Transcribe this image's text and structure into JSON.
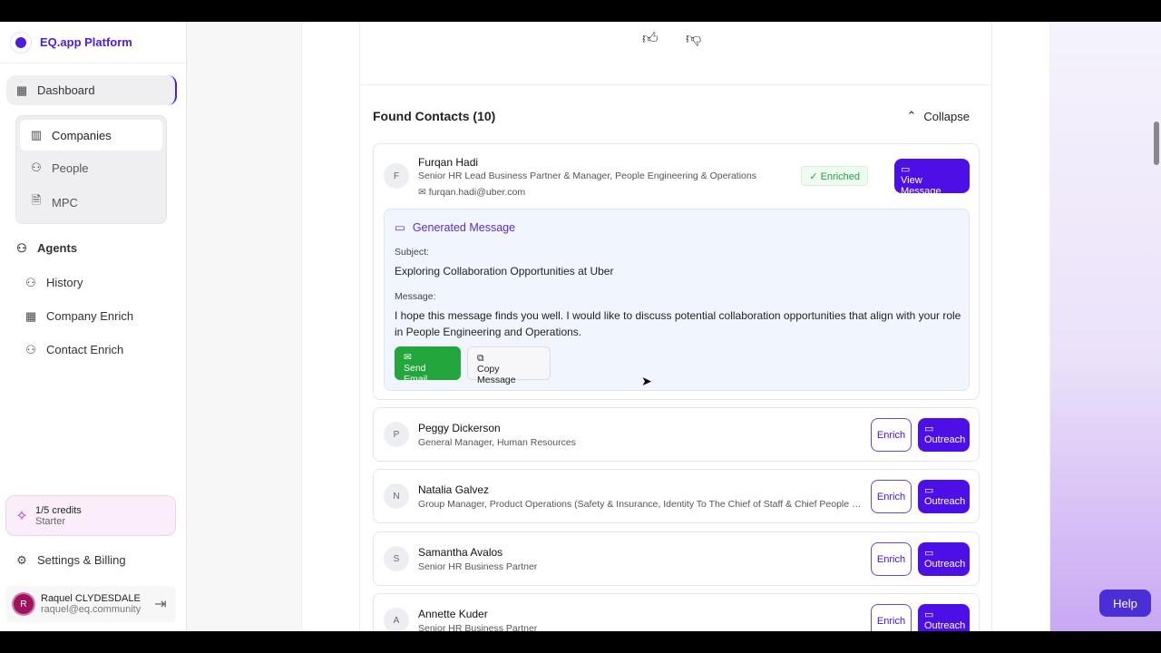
{
  "sidebar": {
    "brand": "EQ.app Platform",
    "dashboard": "Dashboard",
    "sub_items": [
      "Companies",
      "People",
      "MPC"
    ],
    "agents": "Agents",
    "agent_items": [
      "History",
      "Company Enrich",
      "Contact Enrich"
    ],
    "credits": "1/5 credits",
    "plan": "Starter",
    "settings": "Settings & Billing",
    "user_name": "Raquel CLYDESDALE",
    "user_email": "raquel@eq.community",
    "user_initial": "R"
  },
  "main": {
    "found_title": "Found Contacts (10)",
    "collapse": "Collapse",
    "expanded": {
      "initial": "F",
      "name": "Furqan Hadi",
      "role": "Senior HR Lead Business Partner & Manager, People Engineering & Operations",
      "email": "furqan.hadi@uber.com",
      "badge": "✓ Enriched",
      "view_btn": "View Message",
      "gen_title": "Generated Message",
      "subject_label": "Subject:",
      "subject": "Exploring Collaboration Opportunities at Uber",
      "message_label": "Message:",
      "message": "I hope this message finds you well. I would like to discuss potential collaboration opportunities that align with your role in People Engineering and Operations.",
      "send": "Send Email",
      "copy": "Copy Message"
    },
    "contacts": [
      {
        "initial": "P",
        "name": "Peggy Dickerson",
        "role": "General Manager, Human Resources"
      },
      {
        "initial": "N",
        "name": "Natalia Galvez",
        "role": "Group Manager, Product Operations (Safety & Insurance, Identity To The Chief of Staff & Chief People O..."
      },
      {
        "initial": "S",
        "name": "Samantha Avalos",
        "role": "Senior HR Business Partner"
      },
      {
        "initial": "A",
        "name": "Annette Kuder",
        "role": "Senior HR Business Partner"
      }
    ],
    "enrich": "Enrich",
    "outreach": "Outreach"
  },
  "help": "Help"
}
